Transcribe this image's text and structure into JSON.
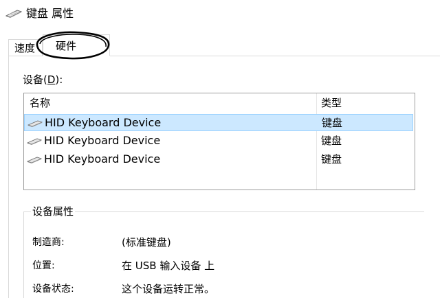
{
  "window": {
    "title": "键盘 属性",
    "icon": "keyboard-icon"
  },
  "tabs": [
    {
      "label": "速度",
      "selected": false
    },
    {
      "label": "硬件",
      "selected": true
    }
  ],
  "devices": {
    "label_prefix": "设备(",
    "label_accel": "D",
    "label_suffix": "):",
    "columns": {
      "name": "名称",
      "type": "类型"
    },
    "rows": [
      {
        "name": "HID Keyboard Device",
        "type": "键盘",
        "selected": true
      },
      {
        "name": "HID Keyboard Device",
        "type": "键盘",
        "selected": false
      },
      {
        "name": "HID Keyboard Device",
        "type": "键盘",
        "selected": false
      }
    ]
  },
  "properties": {
    "title": "设备属性",
    "items": [
      {
        "label": "制造商:",
        "value": "(标准键盘)"
      },
      {
        "label": "位置:",
        "value": "在 USB 输入设备 上"
      },
      {
        "label": "设备状态:",
        "value": "这个设备运转正常。"
      }
    ]
  },
  "colors": {
    "selection_bg": "#cce8ff",
    "selection_border": "#99d1ff",
    "highlight_ring": "#000000"
  }
}
